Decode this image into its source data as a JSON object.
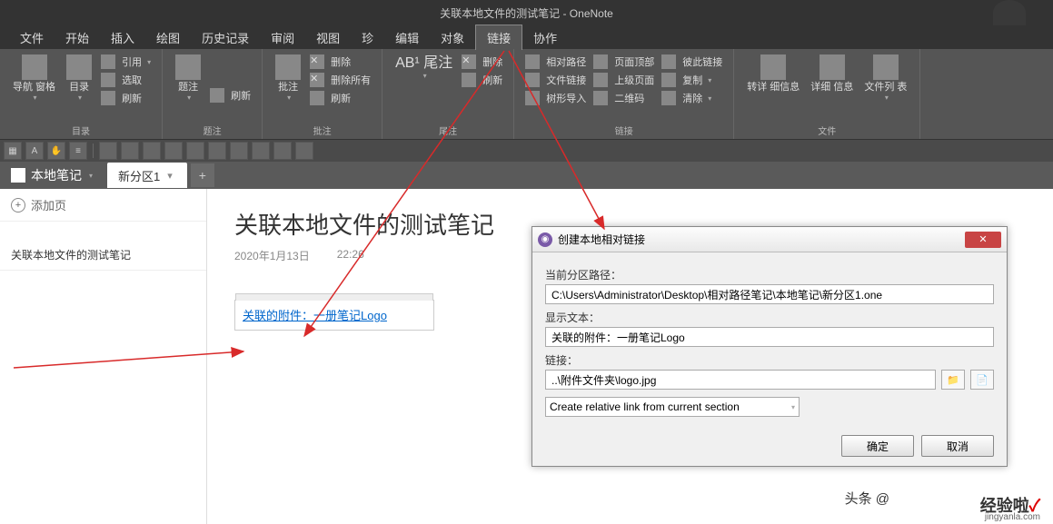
{
  "app": {
    "title": "关联本地文件的测试笔记  -  OneNote"
  },
  "menu": [
    "文件",
    "开始",
    "插入",
    "绘图",
    "历史记录",
    "审阅",
    "视图",
    "珍",
    "编辑",
    "对象",
    "链接",
    "协作"
  ],
  "menu_active_index": 10,
  "ribbon": {
    "g1": {
      "btn1": "导航\n窗格",
      "btn2": "目录",
      "sm1": "引用",
      "sm2": "选取",
      "sm3": "刷新",
      "label": "目录"
    },
    "g2": {
      "btn": "题注",
      "sm": "刷新",
      "label": "题注"
    },
    "g3": {
      "btn": "批注",
      "sm1": "删除",
      "sm2": "删除所有",
      "sm3": "刷新",
      "label": "批注"
    },
    "g4": {
      "btn": "AB¹\n尾注",
      "sm1": "删除",
      "sm2": "刷新",
      "label": "尾注"
    },
    "g5": {
      "c1a": "相对路径",
      "c1b": "文件链接",
      "c1c": "树形导入",
      "c2a": "页面顶部",
      "c2b": "上级页面",
      "c2c": "二维码",
      "c3a": "彼此链接",
      "c3b": "复制",
      "c3c": "清除",
      "label": "链接"
    },
    "g6": {
      "b1": "转详\n细信息",
      "b2": "详细\n信息",
      "b3": "文件列\n表",
      "label": "文件"
    }
  },
  "notebook": {
    "name": "本地笔记",
    "section": "新分区1"
  },
  "sidebar": {
    "add": "添加页",
    "page1": "关联本地文件的测试笔记"
  },
  "note": {
    "title": "关联本地文件的测试笔记",
    "date": "2020年1月13日",
    "time": "22:26",
    "link_text": "关联的附件：一册笔记Logo"
  },
  "dialog": {
    "title": "创建本地相对链接",
    "label_path": "当前分区路径：",
    "path": "C:\\Users\\Administrator\\Desktop\\相对路径笔记\\本地笔记\\新分区1.one",
    "label_display": "显示文本：",
    "display": "关联的附件：一册笔记Logo",
    "label_link": "链接：",
    "link": "..\\附件文件夹\\logo.jpg",
    "select": "Create relative link from current section",
    "ok": "确定",
    "cancel": "取消"
  },
  "watermark": {
    "toutiao": "头条 @",
    "main": "经验啦",
    "check": "✓",
    "sub": "jingyanla.com"
  }
}
